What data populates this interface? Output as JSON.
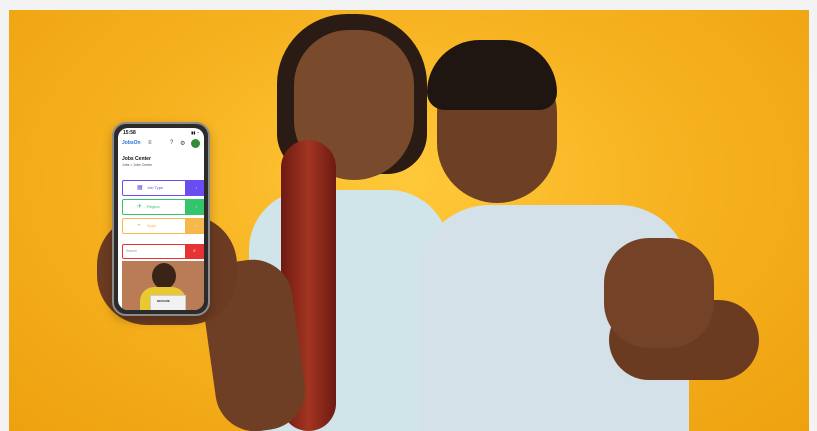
{
  "phone": {
    "status_time": "15:58",
    "app_logo": "JobsOn",
    "page_title": "Jobs Center",
    "breadcrumb": "Jobs  >  Jobs Center",
    "menu": [
      {
        "label": "Job Type",
        "icon": "building-icon",
        "accent": "#6a4cf0"
      },
      {
        "label": "Region",
        "icon": "plane-icon",
        "accent": "#34c46b"
      },
      {
        "label": "Apps",
        "icon": "car-icon",
        "accent": "#f5b84a"
      }
    ],
    "search_placeholder": "Search",
    "promo_paper_text": "RESUME"
  },
  "colors": {
    "background": "#f7b321",
    "search_accent": "#e63434"
  }
}
